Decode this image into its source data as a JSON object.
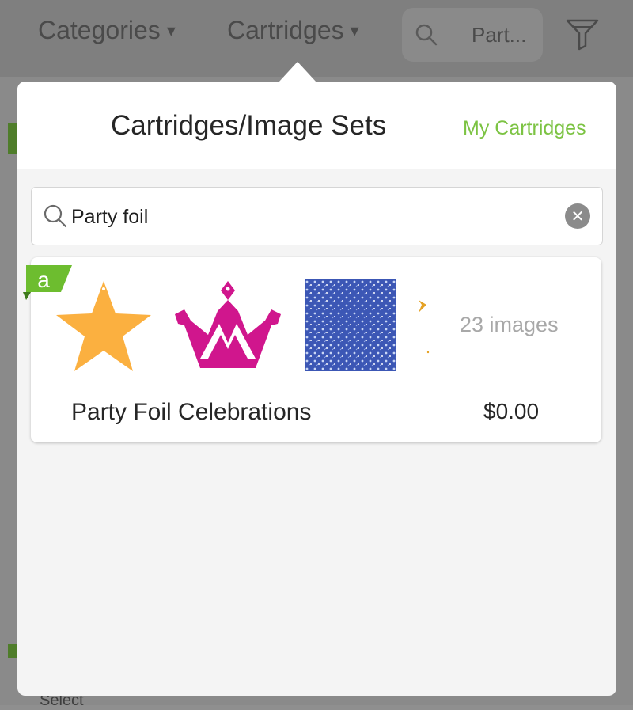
{
  "nav": {
    "categories_label": "Categories",
    "cartridges_label": "Cartridges",
    "caret": "▾",
    "search_text": "Part...",
    "search_icon": "search-icon",
    "filter_icon": "funnel-icon"
  },
  "background": {
    "select_label": "Select"
  },
  "popover": {
    "title": "Cartridges/Image Sets",
    "my_cartridges_label": "My Cartridges",
    "search": {
      "value": "Party foil",
      "icon": "search-icon",
      "clear_icon": "clear-icon"
    },
    "results": [
      {
        "badge": "a",
        "name": "Party Foil Celebrations",
        "price": "$0.00",
        "image_count": "23 images",
        "thumbnails": [
          "star-image",
          "crown-image",
          "pattern-image",
          "partial-image"
        ]
      }
    ]
  },
  "colors": {
    "accent_green": "#7cc343",
    "badge_green": "#6dbd2f",
    "star_orange": "#fbb040",
    "crown_magenta": "#d0168d",
    "pattern_blue": "#3c57b5"
  }
}
